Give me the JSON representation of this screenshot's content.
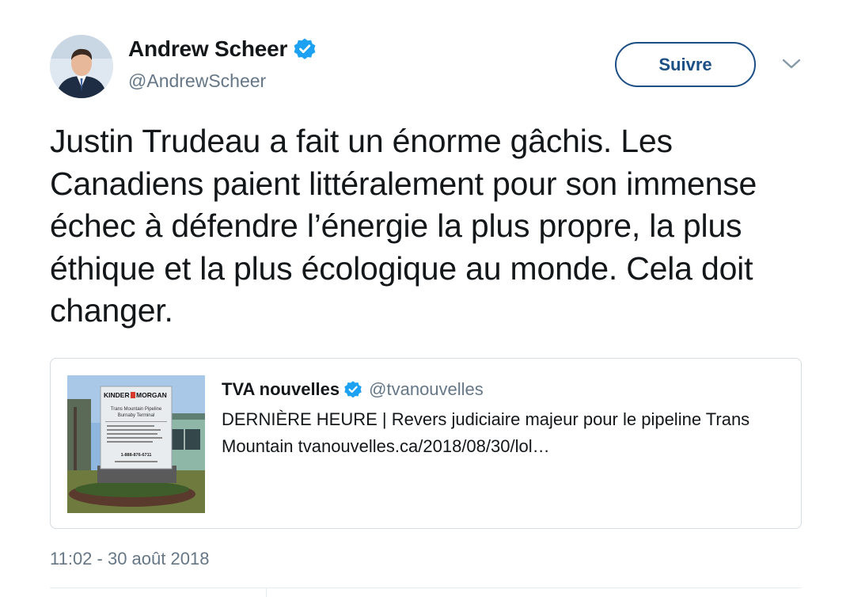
{
  "author": {
    "display_name": "Andrew Scheer",
    "handle": "@AndrewScheer",
    "verified": true
  },
  "actions": {
    "follow_label": "Suivre"
  },
  "tweet": {
    "text": "Justin Trudeau a fait un énorme gâchis. Les Canadiens paient littéralement pour son immense échec à défendre l’énergie la plus propre, la plus éthique et la plus écologique au monde. Cela doit changer.",
    "timestamp": "11:02 - 30 août 2018"
  },
  "quoted_tweet": {
    "display_name": "TVA nouvelles",
    "handle": "@tvanouvelles",
    "verified": true,
    "text": "DERNIÈRE HEURE | Revers judiciaire majeur pour le pipeline Trans Mountain tvanouvelles.ca/2018/08/30/lol…",
    "image": {
      "sign_brand": "KINDER MORGAN",
      "sign_lines": [
        "Trans Mountain Pipeline",
        "Burnaby Terminal"
      ],
      "sign_phone": "1-888-876-6711"
    }
  },
  "colors": {
    "accent": "#1b4f85",
    "verified_blue": "#1da1f2",
    "secondary_text": "#657786",
    "border": "#d6dce0"
  },
  "icons": [
    "verified-badge-icon",
    "chevron-down-icon"
  ]
}
